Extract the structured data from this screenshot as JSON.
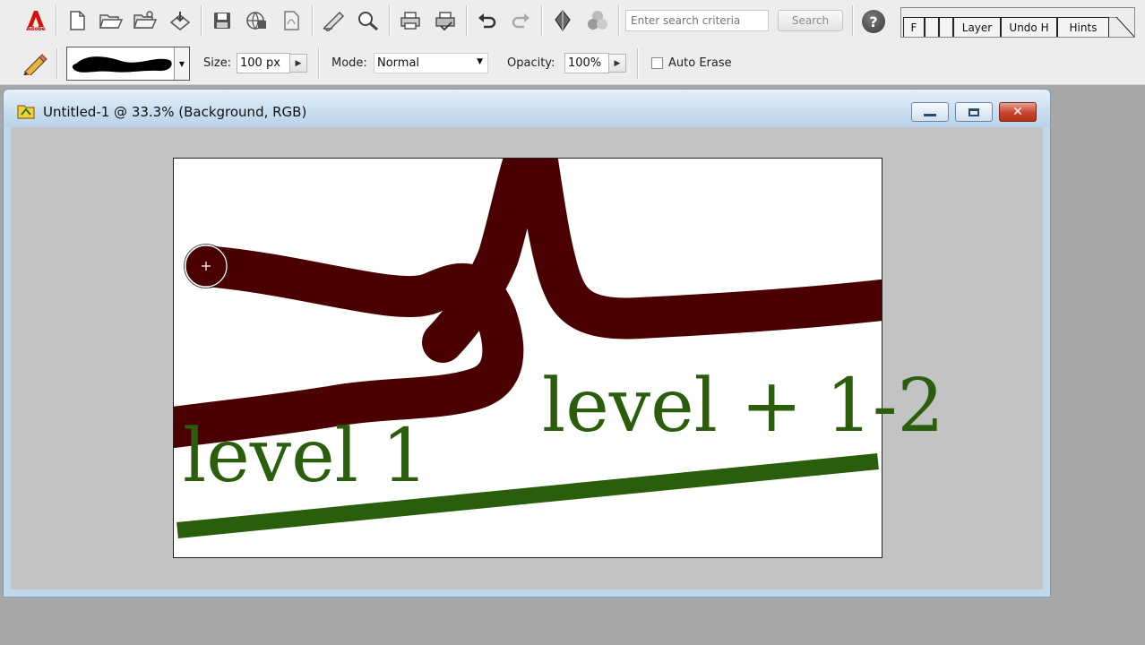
{
  "toolbar": {
    "icons": [
      "adobe-logo-icon",
      "new-file-icon",
      "open-file-icon",
      "browse-icon",
      "import-icon",
      "save-icon",
      "save-for-web-icon",
      "export-pdf-icon",
      "edit-icon",
      "zoom-icon",
      "print-icon",
      "print-options-icon",
      "undo-icon",
      "redo-icon",
      "fill-icon",
      "color-icon",
      "help-icon"
    ],
    "adobe_label": "Adobe",
    "search_placeholder": "Enter search criteria",
    "search_label": "Search",
    "help_label": "?"
  },
  "palette_well": {
    "tabs": [
      {
        "label": "F"
      },
      {
        "label": ""
      },
      {
        "label": ""
      },
      {
        "label": "Layer"
      },
      {
        "label": "Undo H"
      },
      {
        "label": "Hints"
      }
    ]
  },
  "options": {
    "tool": "pencil-icon",
    "brush_preview": "brush-stroke",
    "size_label": "Size:",
    "size_value": "100 px",
    "mode_label": "Mode:",
    "mode_value": "Normal",
    "opacity_label": "Opacity:",
    "opacity_value": "100%",
    "auto_erase_label": "Auto Erase",
    "auto_erase_checked": false
  },
  "document": {
    "title": "Untitled-1 @ 33.3% (Background, RGB)",
    "controls": [
      "minimize-icon",
      "restore-icon",
      "close-icon"
    ],
    "close_label": "✕",
    "canvas": {
      "text_1": "level 1",
      "text_2": "level + 1-2",
      "stroke_color": "#4a0000",
      "line_color": "#2a5e0c"
    }
  },
  "colors": {
    "accent": "#2a5e0c",
    "stroke": "#4a0000",
    "title_bar": "#cbdff0"
  }
}
